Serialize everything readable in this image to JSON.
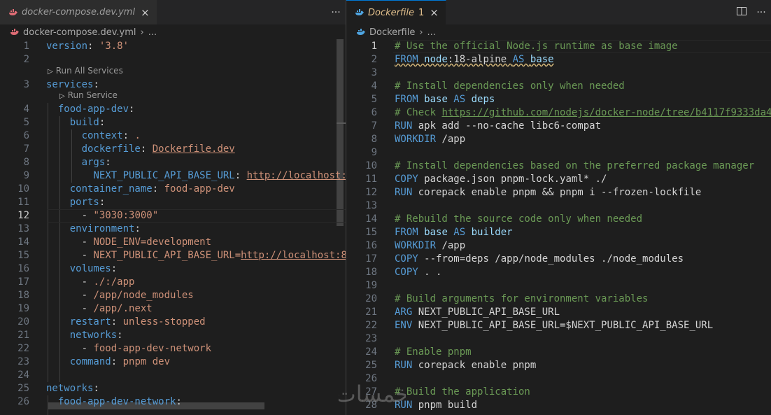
{
  "left_editor": {
    "tab": {
      "label": "docker-compose.dev.yml",
      "close_icon": "×"
    },
    "tab_actions": {
      "more_icon": "···"
    },
    "breadcrumb": {
      "file": "docker-compose.dev.yml",
      "sep": "›",
      "tail": "..."
    },
    "codelens": {
      "run_all": "Run All Services",
      "run_service": "Run Service"
    },
    "active_line": 12,
    "lines": [
      {
        "n": "1",
        "tokens": [
          {
            "c": "key",
            "t": "version"
          },
          {
            "c": "txt",
            "t": ": "
          },
          {
            "c": "str",
            "t": "'3.8'"
          }
        ]
      },
      {
        "n": "2",
        "tokens": []
      },
      {
        "n": "3",
        "tokens": [
          {
            "c": "key",
            "t": "services"
          },
          {
            "c": "txt",
            "t": ":"
          }
        ]
      },
      {
        "n": "4",
        "tokens": [
          {
            "c": "txt",
            "t": "  "
          },
          {
            "c": "key",
            "t": "food-app-dev"
          },
          {
            "c": "txt",
            "t": ":"
          }
        ]
      },
      {
        "n": "5",
        "tokens": [
          {
            "c": "txt",
            "t": "    "
          },
          {
            "c": "key",
            "t": "build"
          },
          {
            "c": "txt",
            "t": ":"
          }
        ]
      },
      {
        "n": "6",
        "tokens": [
          {
            "c": "txt",
            "t": "      "
          },
          {
            "c": "key",
            "t": "context"
          },
          {
            "c": "txt",
            "t": ": "
          },
          {
            "c": "str",
            "t": "."
          }
        ]
      },
      {
        "n": "7",
        "tokens": [
          {
            "c": "txt",
            "t": "      "
          },
          {
            "c": "key",
            "t": "dockerfile"
          },
          {
            "c": "txt",
            "t": ": "
          },
          {
            "c": "str link",
            "t": "Dockerfile.dev"
          }
        ]
      },
      {
        "n": "8",
        "tokens": [
          {
            "c": "txt",
            "t": "      "
          },
          {
            "c": "key",
            "t": "args"
          },
          {
            "c": "txt",
            "t": ":"
          }
        ]
      },
      {
        "n": "9",
        "tokens": [
          {
            "c": "txt",
            "t": "        "
          },
          {
            "c": "key",
            "t": "NEXT_PUBLIC_API_BASE_URL"
          },
          {
            "c": "txt",
            "t": ": "
          },
          {
            "c": "str link",
            "t": "http://localhost:"
          }
        ]
      },
      {
        "n": "10",
        "tokens": [
          {
            "c": "txt",
            "t": "    "
          },
          {
            "c": "key",
            "t": "container_name"
          },
          {
            "c": "txt",
            "t": ": "
          },
          {
            "c": "str",
            "t": "food-app-dev"
          }
        ]
      },
      {
        "n": "11",
        "tokens": [
          {
            "c": "txt",
            "t": "    "
          },
          {
            "c": "key",
            "t": "ports"
          },
          {
            "c": "txt",
            "t": ":"
          }
        ]
      },
      {
        "n": "12",
        "tokens": [
          {
            "c": "txt",
            "t": "      - "
          },
          {
            "c": "str",
            "t": "\"3030:3000\""
          }
        ]
      },
      {
        "n": "13",
        "tokens": [
          {
            "c": "txt",
            "t": "    "
          },
          {
            "c": "key",
            "t": "environment"
          },
          {
            "c": "txt",
            "t": ":"
          }
        ]
      },
      {
        "n": "14",
        "tokens": [
          {
            "c": "txt",
            "t": "      - "
          },
          {
            "c": "str",
            "t": "NODE_ENV=development"
          }
        ]
      },
      {
        "n": "15",
        "tokens": [
          {
            "c": "txt",
            "t": "      - "
          },
          {
            "c": "str",
            "t": "NEXT_PUBLIC_API_BASE_URL="
          },
          {
            "c": "str link",
            "t": "http://localhost:8"
          }
        ]
      },
      {
        "n": "16",
        "tokens": [
          {
            "c": "txt",
            "t": "    "
          },
          {
            "c": "key",
            "t": "volumes"
          },
          {
            "c": "txt",
            "t": ":"
          }
        ]
      },
      {
        "n": "17",
        "tokens": [
          {
            "c": "txt",
            "t": "      - "
          },
          {
            "c": "str",
            "t": "./:/app"
          }
        ]
      },
      {
        "n": "18",
        "tokens": [
          {
            "c": "txt",
            "t": "      - "
          },
          {
            "c": "str",
            "t": "/app/node_modules"
          }
        ]
      },
      {
        "n": "19",
        "tokens": [
          {
            "c": "txt",
            "t": "      - "
          },
          {
            "c": "str",
            "t": "/app/.next"
          }
        ]
      },
      {
        "n": "20",
        "tokens": [
          {
            "c": "txt",
            "t": "    "
          },
          {
            "c": "key",
            "t": "restart"
          },
          {
            "c": "txt",
            "t": ": "
          },
          {
            "c": "str",
            "t": "unless-stopped"
          }
        ]
      },
      {
        "n": "21",
        "tokens": [
          {
            "c": "txt",
            "t": "    "
          },
          {
            "c": "key",
            "t": "networks"
          },
          {
            "c": "txt",
            "t": ":"
          }
        ]
      },
      {
        "n": "22",
        "tokens": [
          {
            "c": "txt",
            "t": "      - "
          },
          {
            "c": "str",
            "t": "food-app-dev-network"
          }
        ]
      },
      {
        "n": "23",
        "tokens": [
          {
            "c": "txt",
            "t": "    "
          },
          {
            "c": "key",
            "t": "command"
          },
          {
            "c": "txt",
            "t": ": "
          },
          {
            "c": "str",
            "t": "pnpm dev"
          }
        ]
      },
      {
        "n": "24",
        "tokens": []
      },
      {
        "n": "25",
        "tokens": [
          {
            "c": "key",
            "t": "networks"
          },
          {
            "c": "txt",
            "t": ":"
          }
        ]
      },
      {
        "n": "26",
        "tokens": [
          {
            "c": "txt",
            "t": "  "
          },
          {
            "c": "key",
            "t": "food-app-dev-network"
          },
          {
            "c": "txt",
            "t": ":"
          }
        ]
      }
    ]
  },
  "right_editor": {
    "tab": {
      "label": "Dockerfile",
      "modified_marker": "1",
      "close_icon": "×"
    },
    "tab_actions": {
      "split_icon": "split-editor-icon",
      "more_icon": "···"
    },
    "breadcrumb": {
      "file": "Dockerfile",
      "sep": "›",
      "tail": "..."
    },
    "active_line": 1,
    "lines": [
      {
        "n": "1",
        "tokens": [
          {
            "c": "com",
            "t": "# Use the official Node.js runtime as base image"
          }
        ]
      },
      {
        "n": "2",
        "tokens": [
          {
            "c": "kw squig",
            "t": "FROM "
          },
          {
            "c": "idn squig",
            "t": "node"
          },
          {
            "c": "txt squig",
            "t": ":18-alpine "
          },
          {
            "c": "kw squig",
            "t": "AS "
          },
          {
            "c": "idn squig",
            "t": "base"
          }
        ]
      },
      {
        "n": "3",
        "tokens": []
      },
      {
        "n": "4",
        "tokens": [
          {
            "c": "com",
            "t": "# Install dependencies only when needed"
          }
        ]
      },
      {
        "n": "5",
        "tokens": [
          {
            "c": "kw",
            "t": "FROM "
          },
          {
            "c": "idn",
            "t": "base"
          },
          {
            "c": "kw",
            "t": " AS "
          },
          {
            "c": "idn",
            "t": "deps"
          }
        ]
      },
      {
        "n": "6",
        "tokens": [
          {
            "c": "com",
            "t": "# Check "
          },
          {
            "c": "com link",
            "t": "https://github.com/nodejs/docker-node/tree/b4117f9333da4"
          }
        ]
      },
      {
        "n": "7",
        "tokens": [
          {
            "c": "kw",
            "t": "RUN "
          },
          {
            "c": "txt",
            "t": "apk add --no-cache libc6-compat"
          }
        ]
      },
      {
        "n": "8",
        "tokens": [
          {
            "c": "kw",
            "t": "WORKDIR "
          },
          {
            "c": "txt",
            "t": "/app"
          }
        ]
      },
      {
        "n": "9",
        "tokens": []
      },
      {
        "n": "10",
        "tokens": [
          {
            "c": "com",
            "t": "# Install dependencies based on the preferred package manager"
          }
        ]
      },
      {
        "n": "11",
        "tokens": [
          {
            "c": "kw",
            "t": "COPY "
          },
          {
            "c": "txt",
            "t": "package.json pnpm-lock.yaml* ./"
          }
        ]
      },
      {
        "n": "12",
        "tokens": [
          {
            "c": "kw",
            "t": "RUN "
          },
          {
            "c": "txt",
            "t": "corepack enable pnpm && pnpm i --frozen-lockfile"
          }
        ]
      },
      {
        "n": "13",
        "tokens": []
      },
      {
        "n": "14",
        "tokens": [
          {
            "c": "com",
            "t": "# Rebuild the source code only when needed"
          }
        ]
      },
      {
        "n": "15",
        "tokens": [
          {
            "c": "kw",
            "t": "FROM "
          },
          {
            "c": "idn",
            "t": "base"
          },
          {
            "c": "kw",
            "t": " AS "
          },
          {
            "c": "idn",
            "t": "builder"
          }
        ]
      },
      {
        "n": "16",
        "tokens": [
          {
            "c": "kw",
            "t": "WORKDIR "
          },
          {
            "c": "txt",
            "t": "/app"
          }
        ]
      },
      {
        "n": "17",
        "tokens": [
          {
            "c": "kw",
            "t": "COPY "
          },
          {
            "c": "txt",
            "t": "--from=deps /app/node_modules ./node_modules"
          }
        ]
      },
      {
        "n": "18",
        "tokens": [
          {
            "c": "kw",
            "t": "COPY "
          },
          {
            "c": "txt",
            "t": ". ."
          }
        ]
      },
      {
        "n": "19",
        "tokens": []
      },
      {
        "n": "20",
        "tokens": [
          {
            "c": "com",
            "t": "# Build arguments for environment variables"
          }
        ]
      },
      {
        "n": "21",
        "tokens": [
          {
            "c": "kw",
            "t": "ARG "
          },
          {
            "c": "txt",
            "t": "NEXT_PUBLIC_API_BASE_URL"
          }
        ]
      },
      {
        "n": "22",
        "tokens": [
          {
            "c": "kw",
            "t": "ENV "
          },
          {
            "c": "txt",
            "t": "NEXT_PUBLIC_API_BASE_URL=$NEXT_PUBLIC_API_BASE_URL"
          }
        ]
      },
      {
        "n": "23",
        "tokens": []
      },
      {
        "n": "24",
        "tokens": [
          {
            "c": "com",
            "t": "# Enable pnpm"
          }
        ]
      },
      {
        "n": "25",
        "tokens": [
          {
            "c": "kw",
            "t": "RUN "
          },
          {
            "c": "txt",
            "t": "corepack enable pnpm"
          }
        ]
      },
      {
        "n": "26",
        "tokens": []
      },
      {
        "n": "27",
        "tokens": [
          {
            "c": "com",
            "t": "# Build the application"
          }
        ]
      },
      {
        "n": "28",
        "tokens": [
          {
            "c": "kw",
            "t": "RUN "
          },
          {
            "c": "txt",
            "t": "pnpm build"
          }
        ]
      }
    ]
  },
  "watermark": {
    "text": "خمسات"
  },
  "colors": {
    "tab_accent": "#0078d4",
    "modified": "#e2c08d",
    "docker_icon": "#e06c75"
  }
}
